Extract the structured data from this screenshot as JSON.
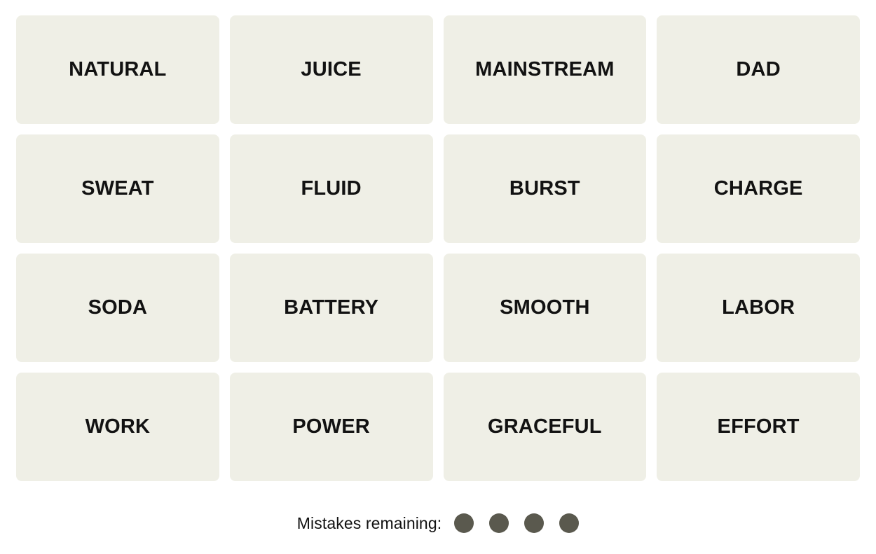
{
  "game": {
    "name": "Connections",
    "background_color": "#ffffff"
  },
  "grid": {
    "rows": 4,
    "columns": 4,
    "tile_background": "#efefe6",
    "tile_text_color": "#121212",
    "tiles": [
      {
        "label": "NATURAL",
        "row": 1,
        "column": 1,
        "selected": false
      },
      {
        "label": "JUICE",
        "row": 1,
        "column": 2,
        "selected": false
      },
      {
        "label": "MAINSTREAM",
        "row": 1,
        "column": 3,
        "selected": false
      },
      {
        "label": "DAD",
        "row": 1,
        "column": 4,
        "selected": false
      },
      {
        "label": "SWEAT",
        "row": 2,
        "column": 1,
        "selected": false
      },
      {
        "label": "FLUID",
        "row": 2,
        "column": 2,
        "selected": false
      },
      {
        "label": "BURST",
        "row": 2,
        "column": 3,
        "selected": false
      },
      {
        "label": "CHARGE",
        "row": 2,
        "column": 4,
        "selected": false
      },
      {
        "label": "SODA",
        "row": 3,
        "column": 1,
        "selected": false
      },
      {
        "label": "BATTERY",
        "row": 3,
        "column": 2,
        "selected": false
      },
      {
        "label": "SMOOTH",
        "row": 3,
        "column": 3,
        "selected": false
      },
      {
        "label": "LABOR",
        "row": 3,
        "column": 4,
        "selected": false
      },
      {
        "label": "WORK",
        "row": 4,
        "column": 1,
        "selected": false
      },
      {
        "label": "POWER",
        "row": 4,
        "column": 2,
        "selected": false
      },
      {
        "label": "GRACEFUL",
        "row": 4,
        "column": 3,
        "selected": false
      },
      {
        "label": "EFFORT",
        "row": 4,
        "column": 4,
        "selected": false
      }
    ]
  },
  "mistakes": {
    "label": "Mistakes remaining:",
    "remaining": 4,
    "dot_color": "#5a594e",
    "dots": [
      1,
      2,
      3,
      4
    ]
  }
}
